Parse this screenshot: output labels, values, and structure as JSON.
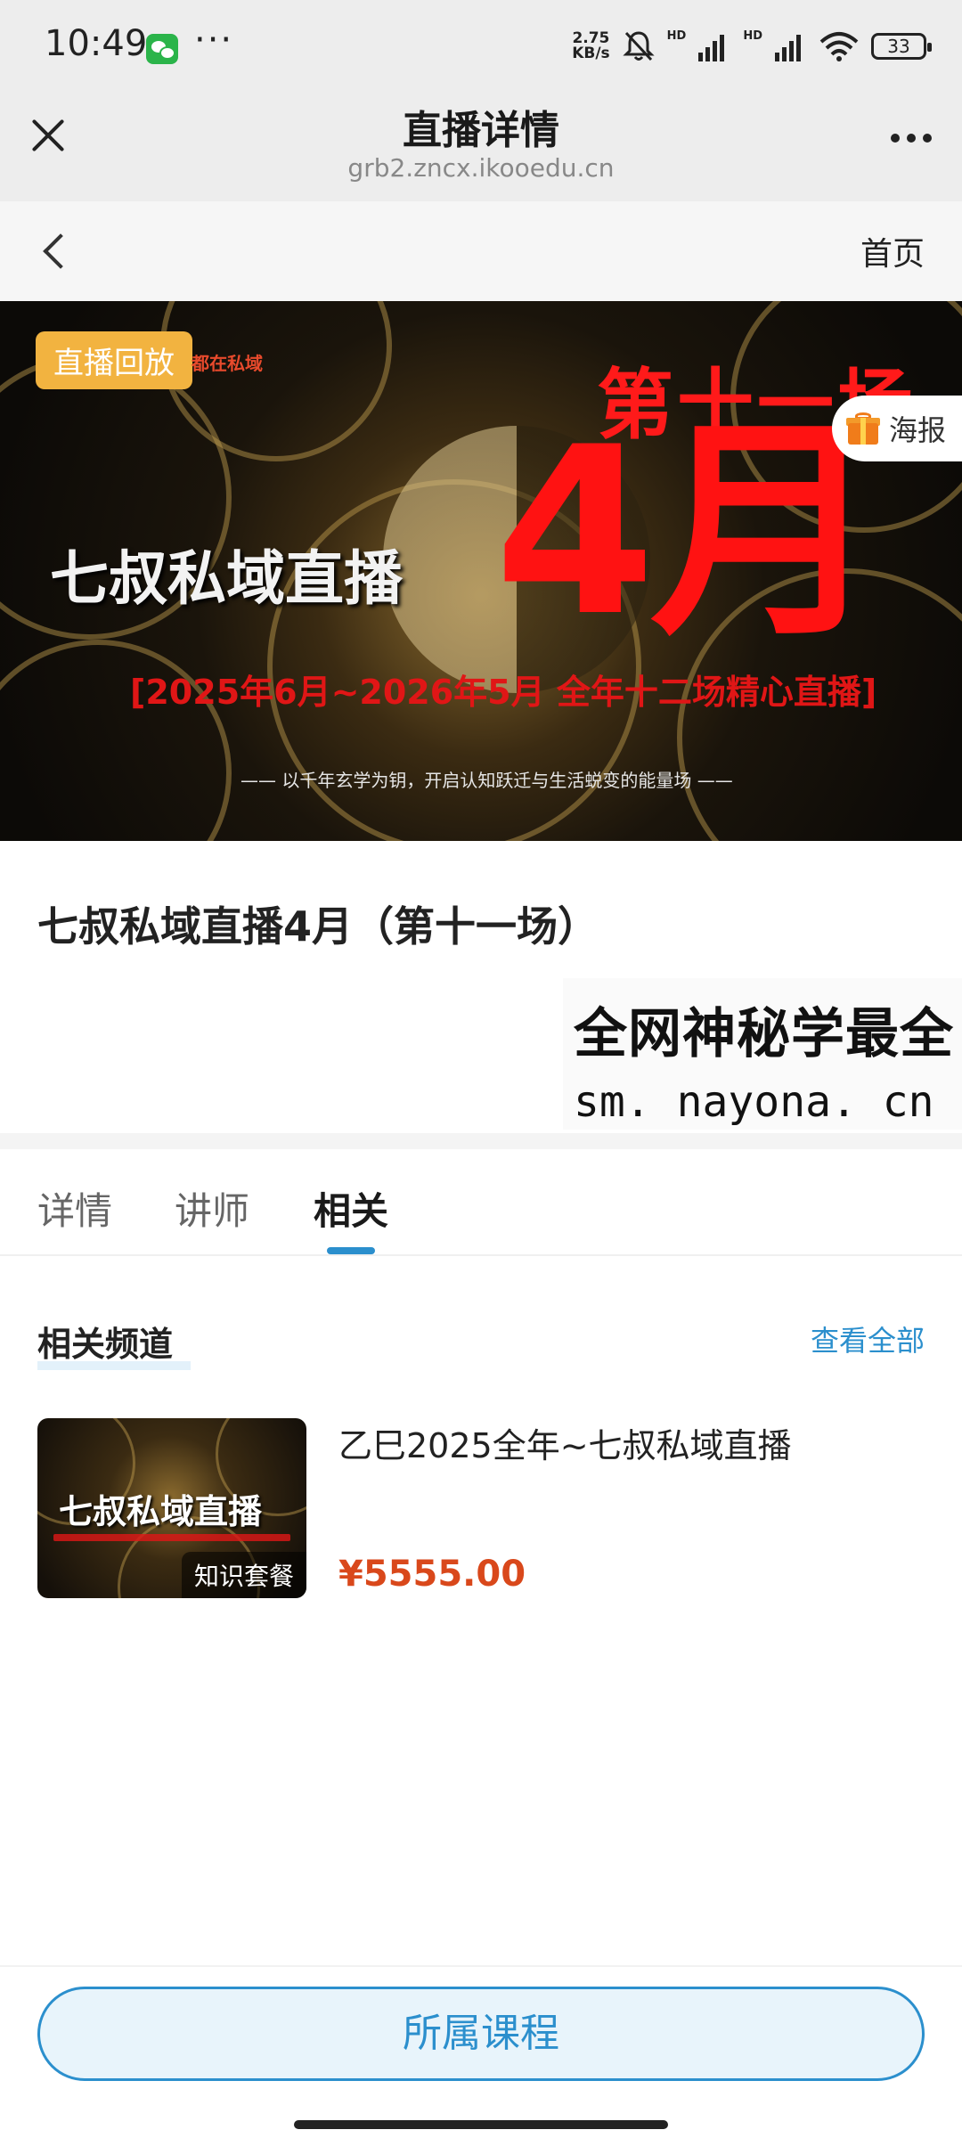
{
  "status_bar": {
    "time": "10:49",
    "more": "···",
    "net_speed_value": "2.75",
    "net_speed_unit": "KB/s",
    "sim1_label": "HD",
    "sim2_label": "HD",
    "battery": "33",
    "icons": [
      "wechat-icon",
      "mute-bell-icon",
      "signal-icon",
      "wifi-icon",
      "battery-icon"
    ]
  },
  "browser": {
    "title": "直播详情",
    "url": "grb2.zncx.ikooedu.cn"
  },
  "nav": {
    "home_label": "首页"
  },
  "banner": {
    "badge": "直播回放",
    "small_text": "都在私域",
    "session": "第十一场",
    "month": "4月",
    "main_title": "七叔私域直播",
    "range": "[2025年6月~2026年5月 全年十二场精心直播]",
    "slogan": "—— 以千年玄学为钥，开启认知跃迁与生活蜕变的能量场 ——",
    "poster_label": "海报"
  },
  "course": {
    "title": "七叔私域直播4月（第十一场）"
  },
  "watermark": {
    "line1": "全网神秘学最全",
    "line2": "sm. nayona. cn"
  },
  "tabs": [
    {
      "label": "详情",
      "active": false
    },
    {
      "label": "讲师",
      "active": false
    },
    {
      "label": "相关",
      "active": true
    }
  ],
  "related": {
    "heading": "相关频道",
    "view_all": "查看全部",
    "items": [
      {
        "thumb_title": "七叔私域直播",
        "thumb_tag": "知识套餐",
        "name": "乙巳2025全年~七叔私域直播",
        "price": "¥5555.00"
      }
    ]
  },
  "bottom": {
    "course_button": "所属课程"
  },
  "colors": {
    "accent": "#2b8fcd",
    "price": "#d9481b",
    "badge": "#f2b340",
    "banner_red": "#ff1a1a"
  }
}
